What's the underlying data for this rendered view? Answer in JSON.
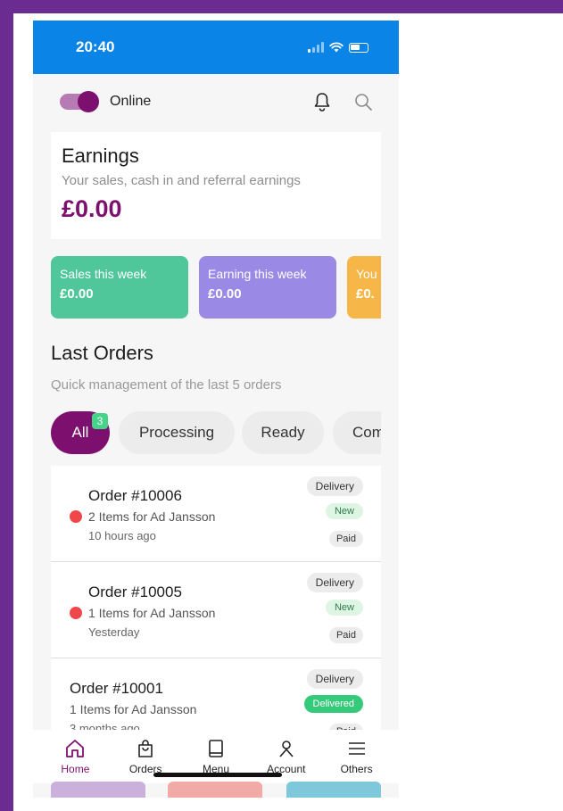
{
  "status_bar": {
    "time": "20:40"
  },
  "topbar": {
    "online_label": "Online"
  },
  "earnings": {
    "title": "Earnings",
    "subtitle": "Your sales, cash in and referral earnings",
    "amount": "£0.00"
  },
  "stat_cards": [
    {
      "label": "Sales this week",
      "value": "£0.00",
      "color": "#4fc79b"
    },
    {
      "label": "Earning this week",
      "value": "£0.00",
      "color": "#9a8ae6"
    },
    {
      "label": "You",
      "value": "£0.",
      "color": "#f7b648"
    }
  ],
  "last_orders": {
    "title": "Last Orders",
    "subtitle": "Quick management of the last 5 orders"
  },
  "filters": [
    {
      "label": "All",
      "badge": "3"
    },
    {
      "label": "Processing"
    },
    {
      "label": "Ready"
    },
    {
      "label": "Com"
    }
  ],
  "orders": [
    {
      "title": "Order #10006",
      "items": "2 Items for Ad Jansson",
      "time": "10 hours ago",
      "type": "Delivery",
      "status": "New",
      "payment": "Paid"
    },
    {
      "title": "Order #10005",
      "items": "1 Items for Ad Jansson",
      "time": "Yesterday",
      "type": "Delivery",
      "status": "New",
      "payment": "Paid"
    },
    {
      "title": "Order #10001",
      "items": "1 Items for Ad Jansson",
      "time": "3 months ago",
      "type": "Delivery",
      "status": "Delivered",
      "payment": "Paid"
    }
  ],
  "tabs": [
    {
      "label": "Home",
      "icon": "home-icon"
    },
    {
      "label": "Orders",
      "icon": "bag-icon"
    },
    {
      "label": "Menu",
      "icon": "book-icon"
    },
    {
      "label": "Account",
      "icon": "user-icon"
    },
    {
      "label": "Others",
      "icon": "hamburger-icon"
    }
  ],
  "colors": {
    "brand": "#7d0f6e",
    "status_bar": "#0a84e6",
    "frame": "#6a2c91",
    "unread_dot": "#f0474b",
    "delivered": "#35c97a"
  }
}
